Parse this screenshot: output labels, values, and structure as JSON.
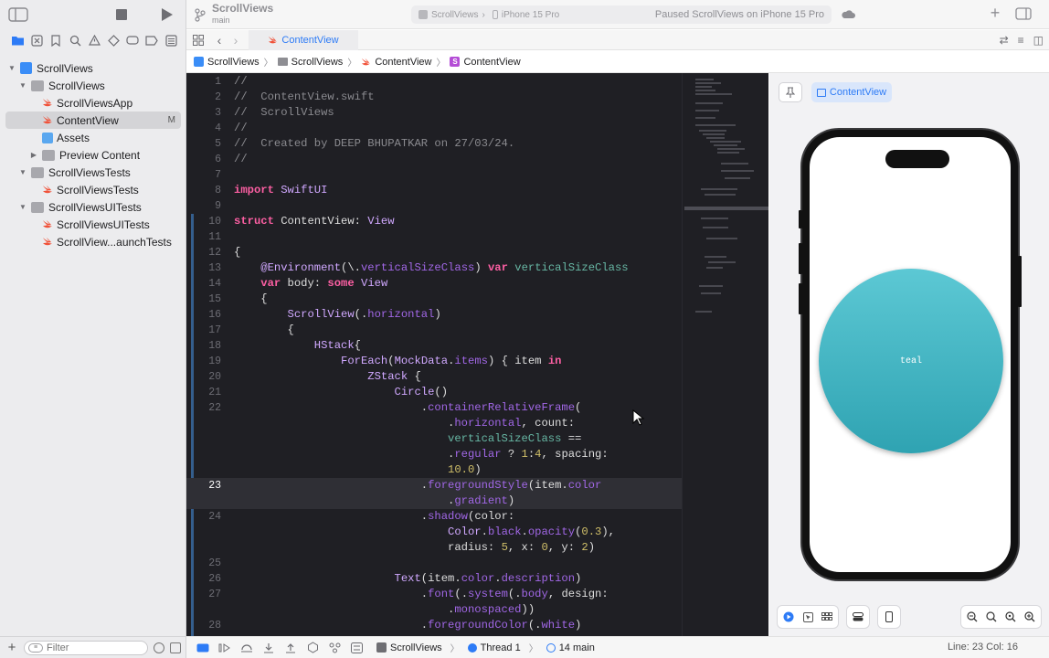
{
  "toolbar": {
    "project_title": "ScrollViews",
    "branch": "main",
    "scheme": "ScrollViews",
    "destination": "iPhone 15 Pro",
    "status": "Paused ScrollViews on iPhone 15 Pro"
  },
  "tabbar": {
    "active_tab": "ContentView"
  },
  "jumpbar": {
    "crumbs": [
      "ScrollViews",
      "ScrollViews",
      "ContentView",
      "ContentView"
    ]
  },
  "navigator": {
    "items": [
      {
        "label": "ScrollViews",
        "kind": "project"
      },
      {
        "label": "ScrollViews",
        "kind": "folder"
      },
      {
        "label": "ScrollViewsApp",
        "kind": "swift"
      },
      {
        "label": "ContentView",
        "kind": "swift",
        "badge": "M"
      },
      {
        "label": "Assets",
        "kind": "assets"
      },
      {
        "label": "Preview Content",
        "kind": "folder"
      },
      {
        "label": "ScrollViewsTests",
        "kind": "folder"
      },
      {
        "label": "ScrollViewsTests",
        "kind": "swift"
      },
      {
        "label": "ScrollViewsUITests",
        "kind": "folder"
      },
      {
        "label": "ScrollViewsUITests",
        "kind": "swift"
      },
      {
        "label": "ScrollView...aunchTests",
        "kind": "swift"
      }
    ],
    "filter_placeholder": "Filter"
  },
  "code": {
    "lines": [
      {
        "n": "1",
        "t": "//"
      },
      {
        "n": "2",
        "t": "//  ContentView.swift"
      },
      {
        "n": "3",
        "t": "//  ScrollViews"
      },
      {
        "n": "4",
        "t": "//"
      },
      {
        "n": "5",
        "t": "//  Created by DEEP BHUPATKAR on 27/03/24."
      },
      {
        "n": "6",
        "t": "//"
      },
      {
        "n": "7",
        "t": ""
      },
      {
        "n": "8",
        "t": "import SwiftUI"
      },
      {
        "n": "9",
        "t": ""
      },
      {
        "n": "10",
        "t": "struct ContentView: View"
      },
      {
        "n": "11",
        "t": ""
      },
      {
        "n": "12",
        "t": "{"
      },
      {
        "n": "13",
        "t": "    @Environment(\\.verticalSizeClass) var verticalSizeClass"
      },
      {
        "n": "14",
        "t": "    var body: some View"
      },
      {
        "n": "15",
        "t": "    {"
      },
      {
        "n": "16",
        "t": "        ScrollView(.horizontal)"
      },
      {
        "n": "17",
        "t": "        {"
      },
      {
        "n": "18",
        "t": "            HStack{"
      },
      {
        "n": "19",
        "t": "                ForEach(MockData.items) { item in"
      },
      {
        "n": "20",
        "t": "                    ZStack {"
      },
      {
        "n": "21",
        "t": "                        Circle()"
      },
      {
        "n": "22",
        "t": "                            .containerRelativeFrame("
      },
      {
        "n": "",
        "t": "                                .horizontal, count:"
      },
      {
        "n": "",
        "t": "                                verticalSizeClass =="
      },
      {
        "n": "",
        "t": "                                .regular ? 1:4, spacing:"
      },
      {
        "n": "",
        "t": "                                10.0)"
      },
      {
        "n": "23",
        "t": "                            .foregroundStyle(item.color"
      },
      {
        "n": "",
        "t": "                                .gradient)"
      },
      {
        "n": "24",
        "t": "                            .shadow(color:"
      },
      {
        "n": "",
        "t": "                                Color.black.opacity(0.3),"
      },
      {
        "n": "",
        "t": "                                radius: 5, x: 0, y: 2)"
      },
      {
        "n": "25",
        "t": ""
      },
      {
        "n": "26",
        "t": "                        Text(item.color.description)"
      },
      {
        "n": "27",
        "t": "                            .font(.system(.body, design:"
      },
      {
        "n": "",
        "t": "                                .monospaced))"
      },
      {
        "n": "28",
        "t": "                            .foregroundColor(.white)"
      }
    ],
    "current_line": "23"
  },
  "preview": {
    "tab_label": "ContentView",
    "circle_label": "teal"
  },
  "statusbar": {
    "scheme": "ScrollViews",
    "thread": "Thread 1",
    "frame": "14 main",
    "line_col": "Line: 23  Col: 16"
  },
  "colors": {
    "accent": "#2d7bf6",
    "editor_bg": "#1f1f24",
    "keyword": "#fc5fa3",
    "teal": "#3bb4c1"
  }
}
